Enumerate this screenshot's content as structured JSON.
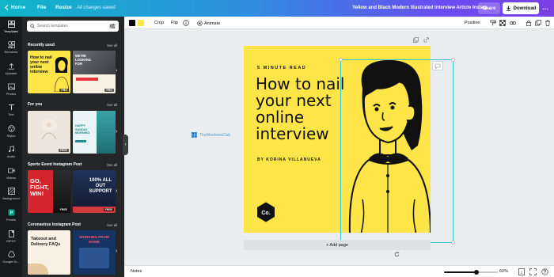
{
  "topbar": {
    "home": "Home",
    "file": "File",
    "resize": "Resize",
    "saved_status": "All changes saved",
    "doc_title": "Yellow and Black Modern Illustrated Interview Article Instag...",
    "share": "Share",
    "download": "Download"
  },
  "rail": {
    "items": [
      {
        "label": "Templates",
        "icon": "templates-icon"
      },
      {
        "label": "Elements",
        "icon": "elements-icon"
      },
      {
        "label": "Uploads",
        "icon": "uploads-icon"
      },
      {
        "label": "Photos",
        "icon": "photos-icon"
      },
      {
        "label": "Text",
        "icon": "text-icon"
      },
      {
        "label": "Styles",
        "icon": "styles-icon"
      },
      {
        "label": "Audio",
        "icon": "audio-icon"
      },
      {
        "label": "Videos",
        "icon": "videos-icon"
      },
      {
        "label": "Background",
        "icon": "background-icon"
      },
      {
        "label": "Pexels",
        "icon": "pexels-icon"
      },
      {
        "label": "GIPHY",
        "icon": "giphy-icon"
      },
      {
        "label": "Google Dr...",
        "icon": "google-drive-icon"
      }
    ]
  },
  "panel": {
    "search_placeholder": "Search templates",
    "sections": [
      {
        "title": "Recently used",
        "see_all": "See all"
      },
      {
        "title": "For you",
        "see_all": "See all"
      },
      {
        "title": "Sports Event Instagram Post",
        "see_all": "See all"
      },
      {
        "title": "Coronavirus Instagram Post",
        "see_all": "See all"
      }
    ],
    "thumbs": {
      "recent1": "How to nail your next online interview",
      "recent2": "WE'RE LOOKING FOR",
      "foryou2": "HAPPY SUNDAY MORNING",
      "sport1": "GO, FIGHT, WIN!",
      "sport2": "100% ALL OUT SUPPORT",
      "corona1": "Takeout and Delivery FAQs",
      "corona2": "WORKING FROM HOME",
      "free": "FREE",
      "pro": "PRO"
    }
  },
  "toolbar": {
    "color1": "#000000",
    "color2": "#ffe547",
    "crop": "Crop",
    "flip": "Flip",
    "animate": "Animate",
    "position": "Position"
  },
  "design": {
    "kicker": "5 MINUTE READ",
    "headline": "How to nail your next online interview",
    "byline": "BY KORINA VILLANUEVA",
    "logo": "Co.",
    "background": "#ffe547"
  },
  "watermark": "TheWindowsClub",
  "canvas": {
    "add_page": "+ Add page"
  },
  "bottombar": {
    "notes": "Notes",
    "zoom": "60%",
    "zoom_fraction": 0.6
  }
}
